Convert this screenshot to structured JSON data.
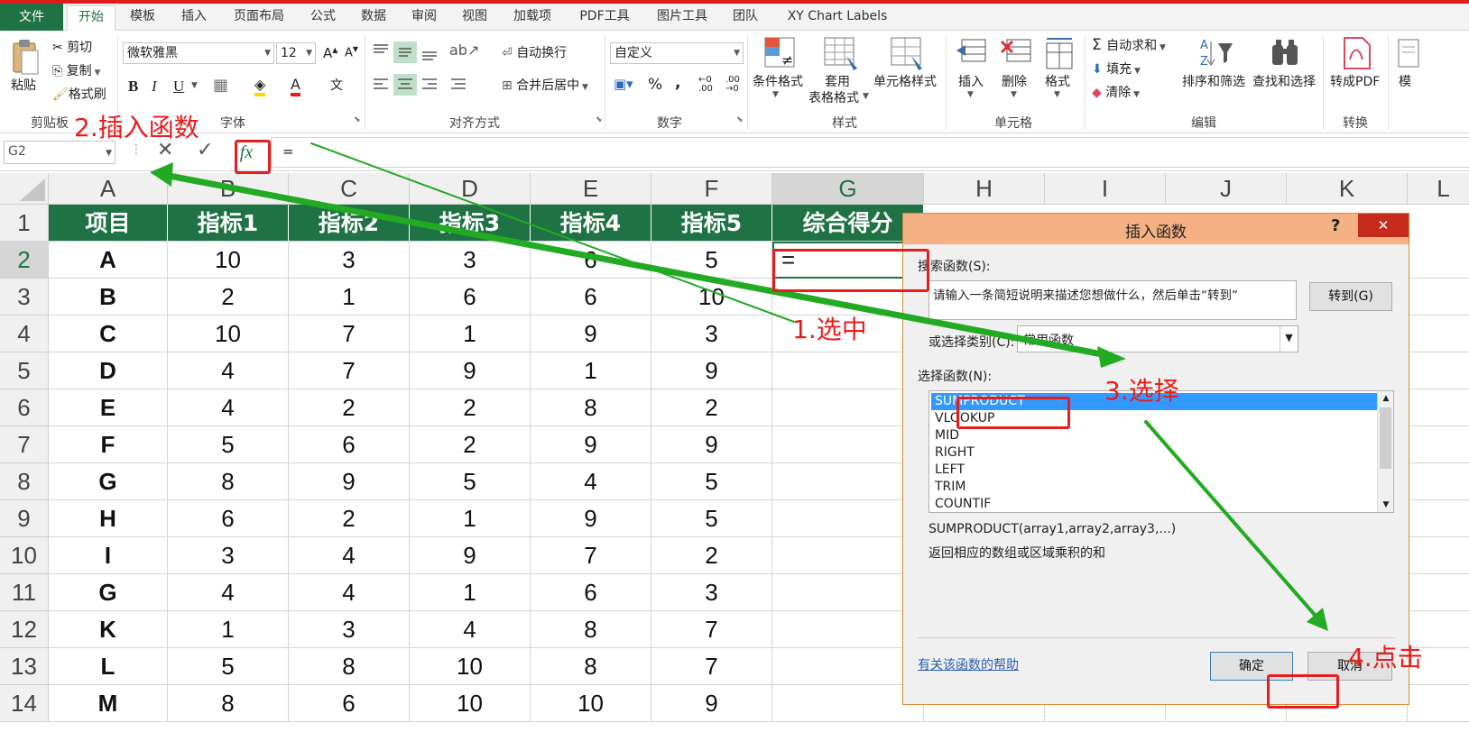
{
  "menu": {
    "file": "文件",
    "tabs": [
      "开始",
      "模板",
      "插入",
      "页面布局",
      "公式",
      "数据",
      "审阅",
      "视图",
      "加载项",
      "PDF工具",
      "图片工具",
      "团队",
      "XY Chart Labels"
    ],
    "active": "开始"
  },
  "ribbon": {
    "clipboard": {
      "paste": "粘贴",
      "cut": "剪切",
      "copy": "复制",
      "format_painter": "格式刷",
      "group": "剪贴板"
    },
    "font": {
      "name": "微软雅黑",
      "size": "12",
      "bold": "B",
      "italic": "I",
      "underline": "U",
      "group": "字体"
    },
    "alignment": {
      "wrap": "自动换行",
      "merge": "合并后居中",
      "group": "对齐方式"
    },
    "number": {
      "format": "自定义",
      "percent": "%",
      "comma": ",",
      "group": "数字"
    },
    "styles": {
      "conditional": "条件格式",
      "table_line1": "套用",
      "table_line2": "表格格式",
      "cell_styles": "单元格样式",
      "group": "样式"
    },
    "cells": {
      "insert": "插入",
      "delete": "删除",
      "format": "格式",
      "group": "单元格"
    },
    "editing": {
      "autosum": "自动求和",
      "fill": "填充",
      "clear": "清除",
      "sort": "排序和筛选",
      "find": "查找和选择",
      "group": "编辑"
    },
    "convert": {
      "pdf": "转成PDF",
      "group": "转换",
      "extra": "模"
    }
  },
  "formula_bar": {
    "name_box": "G2",
    "cancel": "✕",
    "enter": "✓",
    "fx": "fx",
    "formula": "="
  },
  "sheet": {
    "columns": [
      "A",
      "B",
      "C",
      "D",
      "E",
      "F",
      "G",
      "H",
      "I",
      "J",
      "K",
      "L"
    ],
    "selected_column": "G",
    "selected_row": "2",
    "header": [
      "项目",
      "指标1",
      "指标2",
      "指标3",
      "指标4",
      "指标5",
      "综合得分"
    ],
    "rows": [
      {
        "num": "2",
        "cells": [
          "A",
          "10",
          "3",
          "3",
          "6",
          "5",
          "="
        ]
      },
      {
        "num": "3",
        "cells": [
          "B",
          "2",
          "1",
          "6",
          "6",
          "10",
          ""
        ]
      },
      {
        "num": "4",
        "cells": [
          "C",
          "10",
          "7",
          "1",
          "9",
          "3",
          ""
        ]
      },
      {
        "num": "5",
        "cells": [
          "D",
          "4",
          "7",
          "9",
          "1",
          "9",
          ""
        ]
      },
      {
        "num": "6",
        "cells": [
          "E",
          "4",
          "2",
          "2",
          "8",
          "2",
          ""
        ]
      },
      {
        "num": "7",
        "cells": [
          "F",
          "5",
          "6",
          "2",
          "9",
          "9",
          ""
        ]
      },
      {
        "num": "8",
        "cells": [
          "G",
          "8",
          "9",
          "5",
          "4",
          "5",
          ""
        ]
      },
      {
        "num": "9",
        "cells": [
          "H",
          "6",
          "2",
          "1",
          "9",
          "5",
          ""
        ]
      },
      {
        "num": "10",
        "cells": [
          "I",
          "3",
          "4",
          "9",
          "7",
          "2",
          ""
        ]
      },
      {
        "num": "11",
        "cells": [
          "G",
          "4",
          "4",
          "1",
          "6",
          "3",
          ""
        ]
      },
      {
        "num": "12",
        "cells": [
          "K",
          "1",
          "3",
          "4",
          "8",
          "7",
          ""
        ]
      },
      {
        "num": "13",
        "cells": [
          "L",
          "5",
          "8",
          "10",
          "8",
          "7",
          ""
        ]
      },
      {
        "num": "14",
        "cells": [
          "M",
          "8",
          "6",
          "10",
          "10",
          "9",
          ""
        ]
      }
    ],
    "header_row_num": "1"
  },
  "dialog": {
    "title": "插入函数",
    "help_glyph": "?",
    "close": "✕",
    "search_label": "搜索函数(S):",
    "search_text": "请输入一条简短说明来描述您想做什么，然后单击“转到”",
    "goto": "转到(G)",
    "category_label": "或选择类别(C):",
    "category_value": "常用函数",
    "select_label": "选择函数(N):",
    "functions": [
      "SUMPRODUCT",
      "VLOOKUP",
      "MID",
      "RIGHT",
      "LEFT",
      "TRIM",
      "COUNTIF"
    ],
    "selected_function": "SUMPRODUCT",
    "signature": "SUMPRODUCT(array1,array2,array3,...)",
    "description": "返回相应的数组或区域乘积的和",
    "help_link": "有关该函数的帮助",
    "ok": "确定",
    "cancel": "取消"
  },
  "annotations": {
    "step1": "1.选中",
    "step2": "2.插入函数",
    "step3": "3.选择",
    "step4": "4.点击"
  },
  "colors": {
    "excel_green": "#1f7244",
    "annotation_red": "#e81c1c",
    "arrow_green": "#22aa22",
    "dialog_title": "#f4b183",
    "selection_blue": "#3399ff"
  }
}
